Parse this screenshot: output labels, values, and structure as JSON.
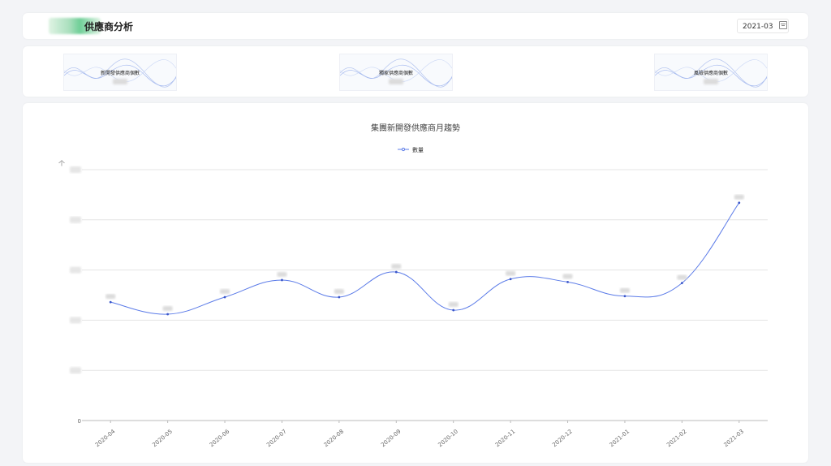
{
  "header": {
    "title": "供應商分析",
    "date_value": "2021-03"
  },
  "kpis": [
    {
      "label": "新開發供應商個數"
    },
    {
      "label": "獨家供應商個數"
    },
    {
      "label": "風險供應商個數"
    }
  ],
  "chart_data": {
    "type": "line",
    "title": "集團新開發供應商月趨勢",
    "legend": [
      "數量"
    ],
    "legend_position": "top-center",
    "smooth": true,
    "grid": true,
    "ylabel": "个",
    "y_tick_labels": [
      "0"
    ],
    "ylim": [
      0,
      25
    ],
    "categories": [
      "2020-04",
      "2020-05",
      "2020-06",
      "2020-07",
      "2020-08",
      "2020-09",
      "2020-10",
      "2020-11",
      "2020-12",
      "2021-01",
      "2021-02",
      "2021-03"
    ],
    "series": [
      {
        "name": "數量",
        "values": [
          11.8,
          10.6,
          12.3,
          14.0,
          12.3,
          14.8,
          11.0,
          14.1,
          13.8,
          12.4,
          13.7,
          21.7
        ]
      }
    ]
  },
  "colors": {
    "line": "#5b7be8",
    "grid": "#e4e4e4",
    "axis": "#bbbbbb"
  }
}
